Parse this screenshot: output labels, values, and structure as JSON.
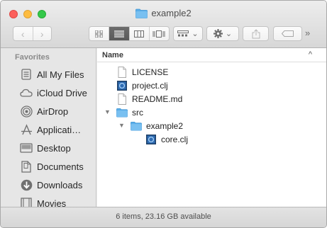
{
  "window": {
    "title": "example2"
  },
  "toolbar": {
    "back_glyph": "‹",
    "forward_glyph": "›",
    "view_modes": [
      "icon-view",
      "list-view",
      "column-view",
      "cover-flow-view"
    ],
    "active_view": "list-view",
    "dropdown_glyph": "⌄",
    "more_glyph": "»"
  },
  "sidebar": {
    "heading": "Favorites",
    "items": [
      {
        "label": "All My Files",
        "icon": "all-files-icon"
      },
      {
        "label": "iCloud Drive",
        "icon": "cloud-icon"
      },
      {
        "label": "AirDrop",
        "icon": "airdrop-icon"
      },
      {
        "label": "Applicati…",
        "icon": "applications-icon"
      },
      {
        "label": "Desktop",
        "icon": "desktop-icon"
      },
      {
        "label": "Documents",
        "icon": "documents-icon"
      },
      {
        "label": "Downloads",
        "icon": "downloads-icon"
      },
      {
        "label": "Movies",
        "icon": "movies-icon"
      }
    ]
  },
  "filelist": {
    "column_name": "Name",
    "sort_glyph": "^",
    "rows": [
      {
        "name": "LICENSE",
        "type": "file",
        "depth": 0
      },
      {
        "name": "project.clj",
        "type": "clj",
        "depth": 0
      },
      {
        "name": "README.md",
        "type": "file",
        "depth": 0
      },
      {
        "name": "src",
        "type": "folder",
        "depth": 0,
        "expanded": true
      },
      {
        "name": "example2",
        "type": "folder",
        "depth": 1,
        "expanded": true
      },
      {
        "name": "core.clj",
        "type": "clj",
        "depth": 2
      }
    ],
    "disclosure_open_glyph": "▼"
  },
  "status": {
    "text": "6 items, 23.16 GB available"
  },
  "colors": {
    "folder": "#5aaee9",
    "selection_dark": "#5f5f5f",
    "clj_blue": "#2f6db5"
  }
}
